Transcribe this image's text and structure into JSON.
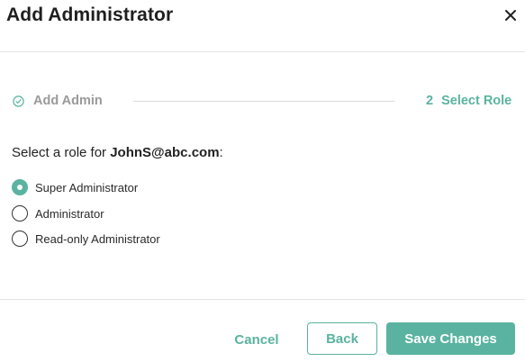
{
  "dialog": {
    "title": "Add Administrator"
  },
  "stepper": {
    "step1": {
      "label": "Add Admin",
      "state": "completed",
      "icon": "check-circle-icon"
    },
    "step2": {
      "number": "2",
      "label": "Select Role",
      "state": "active"
    }
  },
  "prompt": {
    "prefix": "Select a role for ",
    "email": "JohnS@abc.com",
    "suffix": ":"
  },
  "roles": [
    {
      "label": "Super Administrator",
      "selected": true
    },
    {
      "label": "Administrator",
      "selected": false
    },
    {
      "label": "Read-only Administrator",
      "selected": false
    }
  ],
  "footer": {
    "cancel_label": "Cancel",
    "back_label": "Back",
    "save_label": "Save Changes"
  },
  "colors": {
    "accent": "#5ab3a0",
    "muted": "#9a9a9a",
    "text": "#222222"
  }
}
